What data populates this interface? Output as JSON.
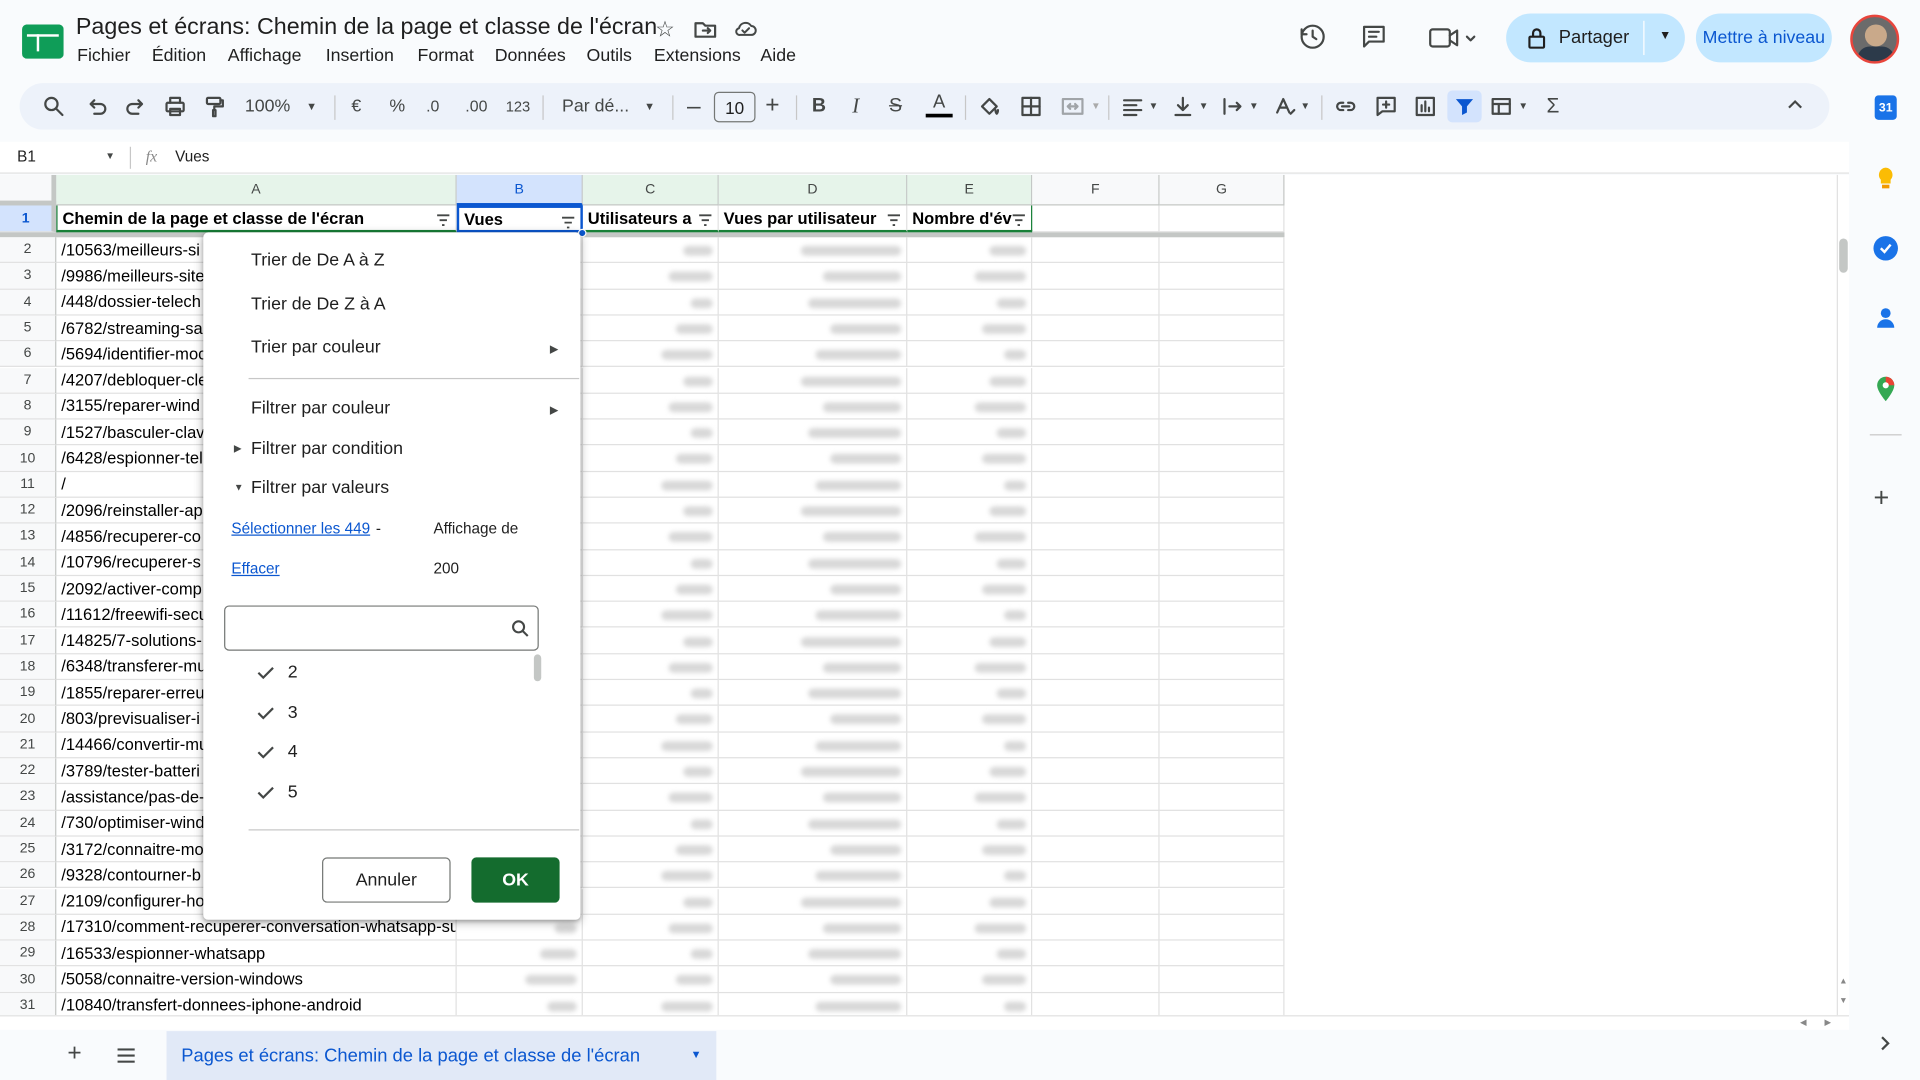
{
  "app": {
    "title": "Pages et écrans: Chemin de la page et classe de l'écran"
  },
  "menus": [
    "Fichier",
    "Édition",
    "Affichage",
    "Insertion",
    "Format",
    "Données",
    "Outils",
    "Extensions",
    "Aide"
  ],
  "header": {
    "share_label": "Partager",
    "upgrade_label": "Mettre à niveau"
  },
  "toolbar": {
    "zoom": "100%",
    "currency": "€",
    "percent": "%",
    "decrease_decimal": ".0",
    "increase_decimal": ".00",
    "number_format": "123",
    "font": "Par dé...",
    "font_size": "10"
  },
  "formula_bar": {
    "cell_ref": "B1",
    "fx": "fx",
    "value": "Vues"
  },
  "grid": {
    "columns": [
      "A",
      "B",
      "C",
      "D",
      "E",
      "F",
      "G"
    ],
    "headers": [
      "Chemin de la page et classe de l'écran",
      "Vues",
      "Utilisateurs a",
      "Vues par utilisateur",
      "Nombre d'év"
    ],
    "rows": [
      {
        "n": "2",
        "a": "/10563/meilleurs-si"
      },
      {
        "n": "3",
        "a": "/9986/meilleurs-site"
      },
      {
        "n": "4",
        "a": "/448/dossier-telech"
      },
      {
        "n": "5",
        "a": "/6782/streaming-sa"
      },
      {
        "n": "6",
        "a": "/5694/identifier-moc"
      },
      {
        "n": "7",
        "a": "/4207/debloquer-cle"
      },
      {
        "n": "8",
        "a": "/3155/reparer-wind"
      },
      {
        "n": "9",
        "a": "/1527/basculer-clav"
      },
      {
        "n": "10",
        "a": "/6428/espionner-tel"
      },
      {
        "n": "11",
        "a": "/"
      },
      {
        "n": "12",
        "a": "/2096/reinstaller-ap"
      },
      {
        "n": "13",
        "a": "/4856/recuperer-co"
      },
      {
        "n": "14",
        "a": "/10796/recuperer-s"
      },
      {
        "n": "15",
        "a": "/2092/activer-comp"
      },
      {
        "n": "16",
        "a": "/11612/freewifi-secu"
      },
      {
        "n": "17",
        "a": "/14825/7-solutions-"
      },
      {
        "n": "18",
        "a": "/6348/transferer-mu"
      },
      {
        "n": "19",
        "a": "/1855/reparer-erreu"
      },
      {
        "n": "20",
        "a": "/803/previsualiser-i"
      },
      {
        "n": "21",
        "a": "/14466/convertir-mu"
      },
      {
        "n": "22",
        "a": "/3789/tester-batteri"
      },
      {
        "n": "23",
        "a": "/assistance/pas-de-"
      },
      {
        "n": "24",
        "a": "/730/optimiser-wind"
      },
      {
        "n": "25",
        "a": "/3172/connaitre-mo"
      },
      {
        "n": "26",
        "a": "/9328/contourner-b"
      },
      {
        "n": "27",
        "a": "/2109/configurer-ho"
      },
      {
        "n": "28",
        "a": "/17310/comment-recuperer-conversation-whatsapp-su"
      },
      {
        "n": "29",
        "a": "/16533/espionner-whatsapp"
      },
      {
        "n": "30",
        "a": "/5058/connaitre-version-windows"
      },
      {
        "n": "31",
        "a": "/10840/transfert-donnees-iphone-android"
      }
    ]
  },
  "filter_popup": {
    "sort_az": "Trier de De A à Z",
    "sort_za": "Trier de De Z à A",
    "sort_color": "Trier par couleur",
    "filter_color": "Filtrer par couleur",
    "filter_condition": "Filtrer par condition",
    "filter_values": "Filtrer par valeurs",
    "select_all": "Sélectionner les 449",
    "select_sep": "-",
    "showing": "Affichage de",
    "clear": "Effacer",
    "showing_count": "200",
    "search_placeholder": "",
    "values": [
      "2",
      "3",
      "4",
      "5"
    ],
    "cancel": "Annuler",
    "ok": "OK"
  },
  "sheet_tab": {
    "label": "Pages et écrans: Chemin de la page et classe de l'écran"
  },
  "colors": {
    "accent": "#0b57d0",
    "ok_green": "#146c2e",
    "share_bg": "#c2e7ff",
    "filter_header": "#e6f4ea"
  }
}
